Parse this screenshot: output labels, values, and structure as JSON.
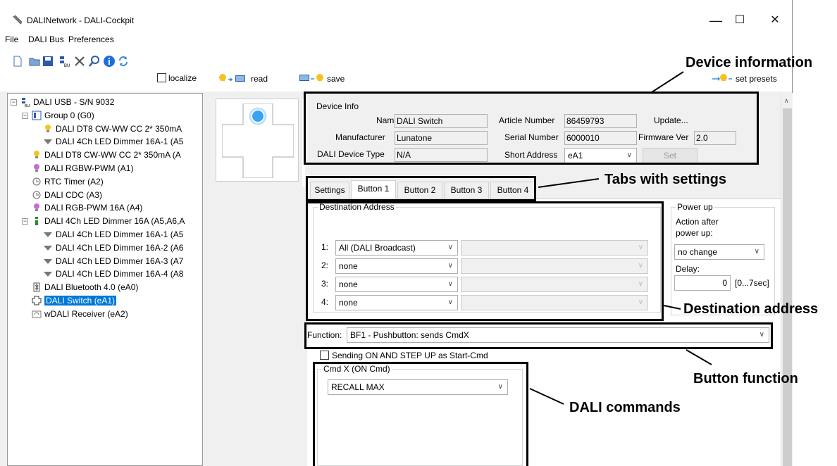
{
  "window": {
    "title": "DALINetwork - DALI-Cockpit",
    "minimize": "—",
    "maximize": "☐",
    "close": "✕"
  },
  "menu": [
    "File",
    "DALI Bus",
    "Preferences"
  ],
  "toolbar": {
    "localize_label": "localize",
    "read_label": "read",
    "save_label": "save",
    "set_presets_label": "set presets"
  },
  "tree": [
    {
      "label": "DALI USB - S/N 9032",
      "icon": "usb-bus-icon",
      "indent": 0,
      "expander": "−"
    },
    {
      "label": "Group 0 (G0)",
      "icon": "group-icon",
      "indent": 1,
      "expander": "−"
    },
    {
      "label": "DALI DT8 CW-WW CC 2* 350mA",
      "icon": "bulb-icon",
      "indent": 2
    },
    {
      "label": "DALI 4Ch LED Dimmer 16A-1 (A5",
      "icon": "lamp-icon",
      "indent": 2
    },
    {
      "label": "DALI DT8 CW-WW CC 2* 350mA (A",
      "icon": "bulb-icon",
      "indent": 1
    },
    {
      "label": "DALI RGBW-PWM (A1)",
      "icon": "rgb-bulb-icon",
      "indent": 1
    },
    {
      "label": "RTC Timer (A2)",
      "icon": "clock-icon",
      "indent": 1
    },
    {
      "label": "DALI CDC (A3)",
      "icon": "clock-icon",
      "indent": 1
    },
    {
      "label": "DALI RGB-PWM 16A (A4)",
      "icon": "rgb-bulb-icon",
      "indent": 1
    },
    {
      "label": "DALI 4Ch LED Dimmer 16A (A5,A6,A",
      "icon": "dimmer-icon",
      "indent": 1,
      "expander": "−"
    },
    {
      "label": "DALI 4Ch LED Dimmer 16A-1 (A5",
      "icon": "lamp-icon",
      "indent": 2
    },
    {
      "label": "DALI 4Ch LED Dimmer 16A-2 (A6",
      "icon": "lamp-icon",
      "indent": 2
    },
    {
      "label": "DALI 4Ch LED Dimmer 16A-3 (A7",
      "icon": "lamp-icon",
      "indent": 2
    },
    {
      "label": "DALI 4Ch LED Dimmer 16A-4 (A8",
      "icon": "lamp-icon",
      "indent": 2
    },
    {
      "label": "DALI Bluetooth 4.0 (eA0)",
      "icon": "bluetooth-icon",
      "indent": 1
    },
    {
      "label": "DALI Switch (eA1)",
      "icon": "switch-icon",
      "indent": 1,
      "selected": true
    },
    {
      "label": "wDALI Receiver (eA2)",
      "icon": "receiver-icon",
      "indent": 1
    }
  ],
  "device_info": {
    "title": "Device Info",
    "name_label": "Name",
    "name_value": "DALI Switch",
    "manufacturer_label": "Manufacturer",
    "manufacturer_value": "Lunatone",
    "device_type_label": "DALI Device Type",
    "device_type_value": "N/A",
    "article_label": "Article Number",
    "article_value": "86459793",
    "serial_label": "Serial Number",
    "serial_value": "6000010",
    "short_address_label": "Short Address",
    "short_address_value": "eA1",
    "update_label": "Update...",
    "firmware_label": "Firmware Ver",
    "firmware_value": "2.0",
    "set_label": "Set"
  },
  "tabs": [
    "Settings",
    "Button 1",
    "Button 2",
    "Button 3",
    "Button 4"
  ],
  "destination": {
    "title": "Destination Address",
    "rows": [
      {
        "num": "1:",
        "value": "All (DALI Broadcast)"
      },
      {
        "num": "2:",
        "value": "none"
      },
      {
        "num": "3:",
        "value": "none"
      },
      {
        "num": "4:",
        "value": "none"
      }
    ]
  },
  "power_up": {
    "title": "Power up",
    "action_label": "Action after power up:",
    "action_value": "no change",
    "delay_label": "Delay:",
    "delay_value": "0",
    "delay_unit": "[0...7sec]"
  },
  "function": {
    "label": "Function:",
    "value": "BF1 - Pushbutton:  sends CmdX"
  },
  "sending_checkbox_label": "Sending ON AND STEP UP as Start-Cmd",
  "cmd": {
    "title": "Cmd X  (ON Cmd)",
    "value": "RECALL MAX"
  },
  "annotations": {
    "device_information": "Device information",
    "tabs_with_settings": "Tabs with settings",
    "destination_address": "Destination address",
    "button_function": "Button function",
    "dali_commands": "DALI commands"
  }
}
